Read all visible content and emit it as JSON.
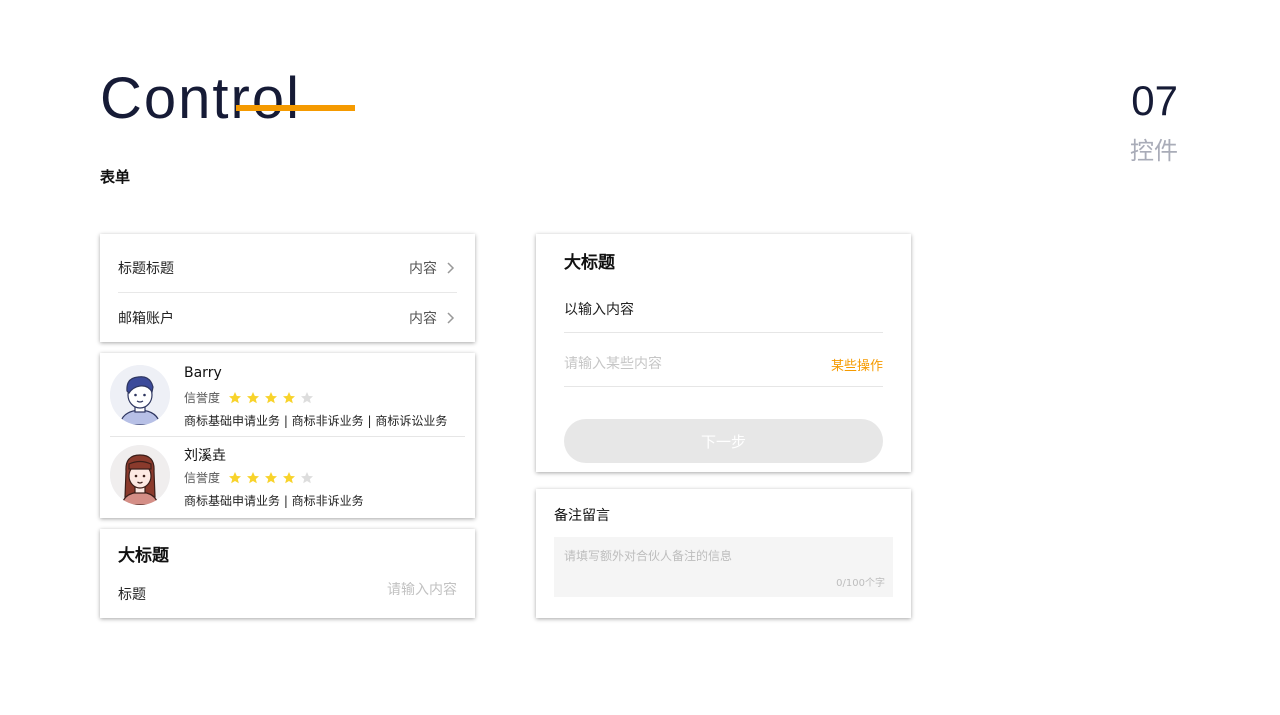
{
  "header": {
    "title": "Control",
    "section": "表单",
    "page_number": "07",
    "page_subtitle": "控件",
    "accent_color": "#f59a00"
  },
  "list_card": {
    "rows": [
      {
        "label": "标题标题",
        "value": "内容"
      },
      {
        "label": "邮箱账户",
        "value": "内容"
      }
    ]
  },
  "people_card": {
    "people": [
      {
        "name": "Barry",
        "rating_label": "信誉度",
        "rating": 4,
        "max_rating": 5,
        "tags": "商标基础申请业务 | 商标非诉业务 | 商标诉讼业务",
        "avatar": "male-avatar-icon"
      },
      {
        "name": "刘溪垚",
        "rating_label": "信誉度",
        "rating": 4,
        "max_rating": 5,
        "tags": "商标基础申请业务 | 商标非诉业务",
        "avatar": "female-avatar-icon"
      }
    ],
    "star_color": "#f8d32b",
    "star_empty_color": "#dddddd"
  },
  "input_card": {
    "title": "大标题",
    "label": "标题",
    "placeholder": "请输入内容"
  },
  "form_card": {
    "title": "大标题",
    "field1_value": "以输入内容",
    "field2_placeholder": "请输入某些内容",
    "action_label": "某些操作",
    "action_color": "#f59a00",
    "button_label": "下一步"
  },
  "note_card": {
    "title": "备注留言",
    "placeholder": "请填写额外对合伙人备注的信息",
    "counter": "0/100个字"
  }
}
